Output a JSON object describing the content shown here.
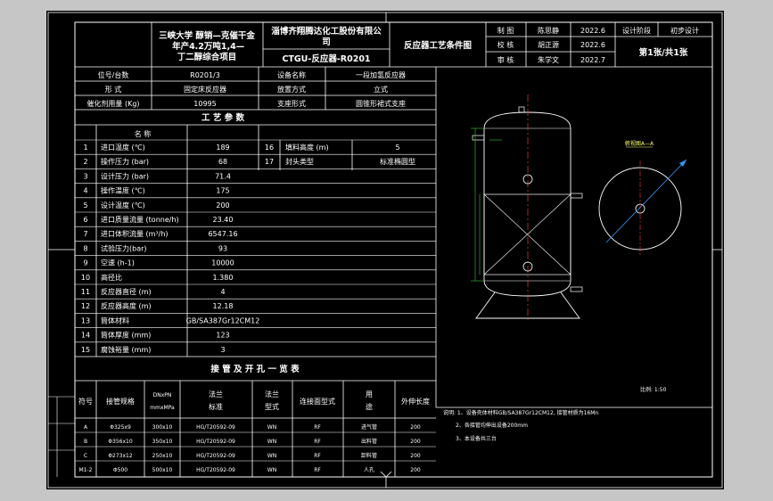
{
  "title_block": {
    "project": "三峡大学 醇销—克催干金 年产4.2万吨1,4—丁二醇综合项目",
    "company": "淄博齐翔腾达化工股份有限公司",
    "drawing_no": "CTGU-反应器-R0201",
    "drawing_title": "反应器工艺条件图",
    "roles": [
      {
        "role": "制  图",
        "name": "陈思静",
        "date": "2022.6"
      },
      {
        "role": "校  核",
        "name": "胡正源",
        "date": "2022.6"
      },
      {
        "role": "审  核",
        "name": "朱学文",
        "date": "2022.7"
      }
    ],
    "stage_label": "设计阶段",
    "stage_value": "初步设计",
    "sheet_info": "第1张/共1张"
  },
  "equipment_info": [
    {
      "label": "位号/台数",
      "value": "R0201/3",
      "label2": "设备名称",
      "value2": "一段加氢反应器"
    },
    {
      "label": "形  式",
      "value": "固定床反应器",
      "label2": "放置方式",
      "value2": "立式"
    },
    {
      "label": "催化剂用量 (Kg)",
      "value": "10995",
      "label2": "支座形式",
      "value2": "圆锥形裙式支座"
    }
  ],
  "process_params": {
    "heading": "工 艺 参 数",
    "col_name": "名 称",
    "rows": [
      {
        "no": "1",
        "name": "进口温度 (℃)",
        "value": "189",
        "no2": "16",
        "name2": "填料高度 (m)",
        "value2": "5"
      },
      {
        "no": "2",
        "name": "操作压力 (bar)",
        "value": "68",
        "no2": "17",
        "name2": "封头类型",
        "value2": "标准椭圆型"
      },
      {
        "no": "3",
        "name": "设计压力 (bar)",
        "value": "71.4"
      },
      {
        "no": "4",
        "name": "操作温度 (℃)",
        "value": "175"
      },
      {
        "no": "5",
        "name": "设计温度 (℃)",
        "value": "200"
      },
      {
        "no": "6",
        "name": "进口质量流量 (tonne/h)",
        "value": "23.40"
      },
      {
        "no": "7",
        "name": "进口体积流量 (m³/h)",
        "value": "6547.16"
      },
      {
        "no": "8",
        "name": "试验压力(bar)",
        "value": "93"
      },
      {
        "no": "9",
        "name": "空速 (h-1)",
        "value": "10000"
      },
      {
        "no": "10",
        "name": "高径比",
        "value": "1.380"
      },
      {
        "no": "11",
        "name": "反应器直径 (m)",
        "value": "4"
      },
      {
        "no": "12",
        "name": "反应器高度 (m)",
        "value": "12.18"
      },
      {
        "no": "13",
        "name": "筒体材料",
        "value": "GB/SA387Gr12CM12"
      },
      {
        "no": "14",
        "name": "筒体厚度 (mm)",
        "value": "123"
      },
      {
        "no": "15",
        "name": "腐蚀裕量 (mm)",
        "value": "3"
      }
    ]
  },
  "nozzle_table": {
    "heading": "接 管 及 开 孔 一 览 表",
    "headers": [
      "符号",
      "接管规格",
      "DNxPN mmxMPa",
      "法兰 标准",
      "法兰 型式",
      "连接面型式",
      "用 途",
      "外伸长度"
    ],
    "rows": [
      {
        "sym": "A",
        "spec": "Φ325x9",
        "dnpn": "300x10",
        "std": "HG/T20592-09",
        "type": "WN",
        "face": "RF",
        "use": "进气管",
        "len": "200"
      },
      {
        "sym": "B",
        "spec": "Φ356x10",
        "dnpn": "350x10",
        "std": "HG/T20592-09",
        "type": "WN",
        "face": "RF",
        "use": "出料管",
        "len": "200"
      },
      {
        "sym": "C",
        "spec": "Φ273x12",
        "dnpn": "250x10",
        "std": "HG/T20592-09",
        "type": "WN",
        "face": "RF",
        "use": "卸料管",
        "len": "200"
      },
      {
        "sym": "M1-2",
        "spec": "Φ500",
        "dnpn": "500x10",
        "std": "HG/T20592-09",
        "type": "WN",
        "face": "RF",
        "use": "人孔",
        "len": "200"
      }
    ]
  },
  "notes": {
    "lines": [
      "说明: 1、设备壳体材料GB/SA387Gr12CM12, 接管材质为16Mn",
      "2、各接管均伸出设备200mm",
      "3、本设备共三台"
    ]
  },
  "drawing": {
    "section_label": "俯视图A—A",
    "scale_label": "比例: 1:50"
  }
}
